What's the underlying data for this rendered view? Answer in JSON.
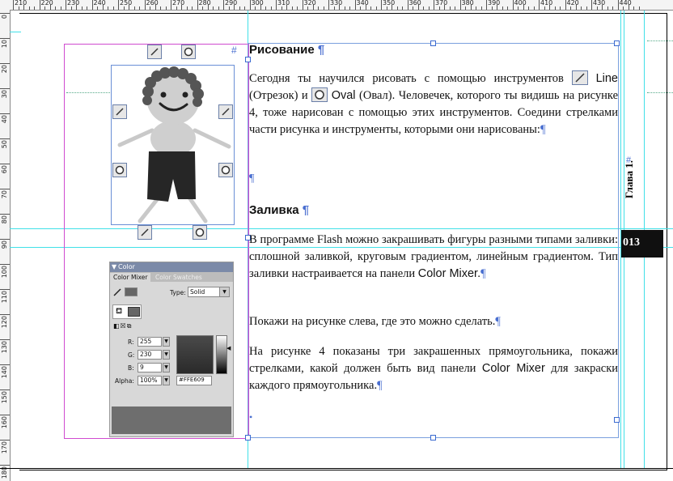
{
  "ruler": {
    "h_labels": [
      "210",
      "220",
      "230",
      "240",
      "250",
      "260",
      "270",
      "280",
      "290",
      "300",
      "310",
      "320",
      "330",
      "340",
      "350",
      "360",
      "370",
      "380",
      "390",
      "400",
      "410",
      "420",
      "430",
      "440"
    ],
    "v_labels": [
      "0",
      "10",
      "20",
      "30",
      "40",
      "50",
      "60",
      "70",
      "80",
      "90",
      "100",
      "110",
      "120",
      "130",
      "140",
      "150",
      "160",
      "170",
      "180"
    ]
  },
  "text": {
    "heading1": "Рисование",
    "para1_a": "Сегодня ты научился рисовать с помощью инструментов",
    "para1_line": "Line",
    "para1_line_ru": "(Отрезок) и",
    "para1_oval": "Oval",
    "para1_oval_ru": "(Овал). Человечек, которого ты видишь на рисунке 4, тоже нарисован с помощью этих инструментов. Соедини стрелками части рисунка и инструменты, которыми они нарисованы:",
    "heading2": "Заливка",
    "para2_a": "В программе Flash можно закрашивать фигуры разными типами заливки: сплошной заливкой, круговым градиентом, линейным градиентом. Тип заливки настраивается на панели",
    "para2_b": "Color Mixer.",
    "para3": "Покажи на рисунке слева, где это можно сделать.",
    "para4_a": "На рисунке 4 показаны три закрашенных прямоугольника, покажи стрелками, какой должен быть вид панели",
    "para4_b": "Color Mixer",
    "para4_c": "для закраски каждого прямоугольника.",
    "pilcrow": "¶",
    "hash": "#",
    "bullet": "•"
  },
  "chapter": {
    "label": "Глава 1.",
    "page_number": "013"
  },
  "color_panel": {
    "title": "Color",
    "tab_mixer": "Color Mixer",
    "tab_swatches": "Color Swatches",
    "type_label": "Type:",
    "type_value": "Solid",
    "r_label": "R:",
    "r_value": "255",
    "g_label": "G:",
    "g_value": "230",
    "b_label": "B:",
    "b_value": "9",
    "alpha_label": "Alpha:",
    "alpha_value": "100%",
    "hex_value": "#FFE609"
  },
  "colors": {
    "guide": "#40e0e8",
    "frame_pink": "#d04bd0",
    "frame_blue": "#6a8fd6",
    "pilcrow": "#4a6fd0"
  }
}
